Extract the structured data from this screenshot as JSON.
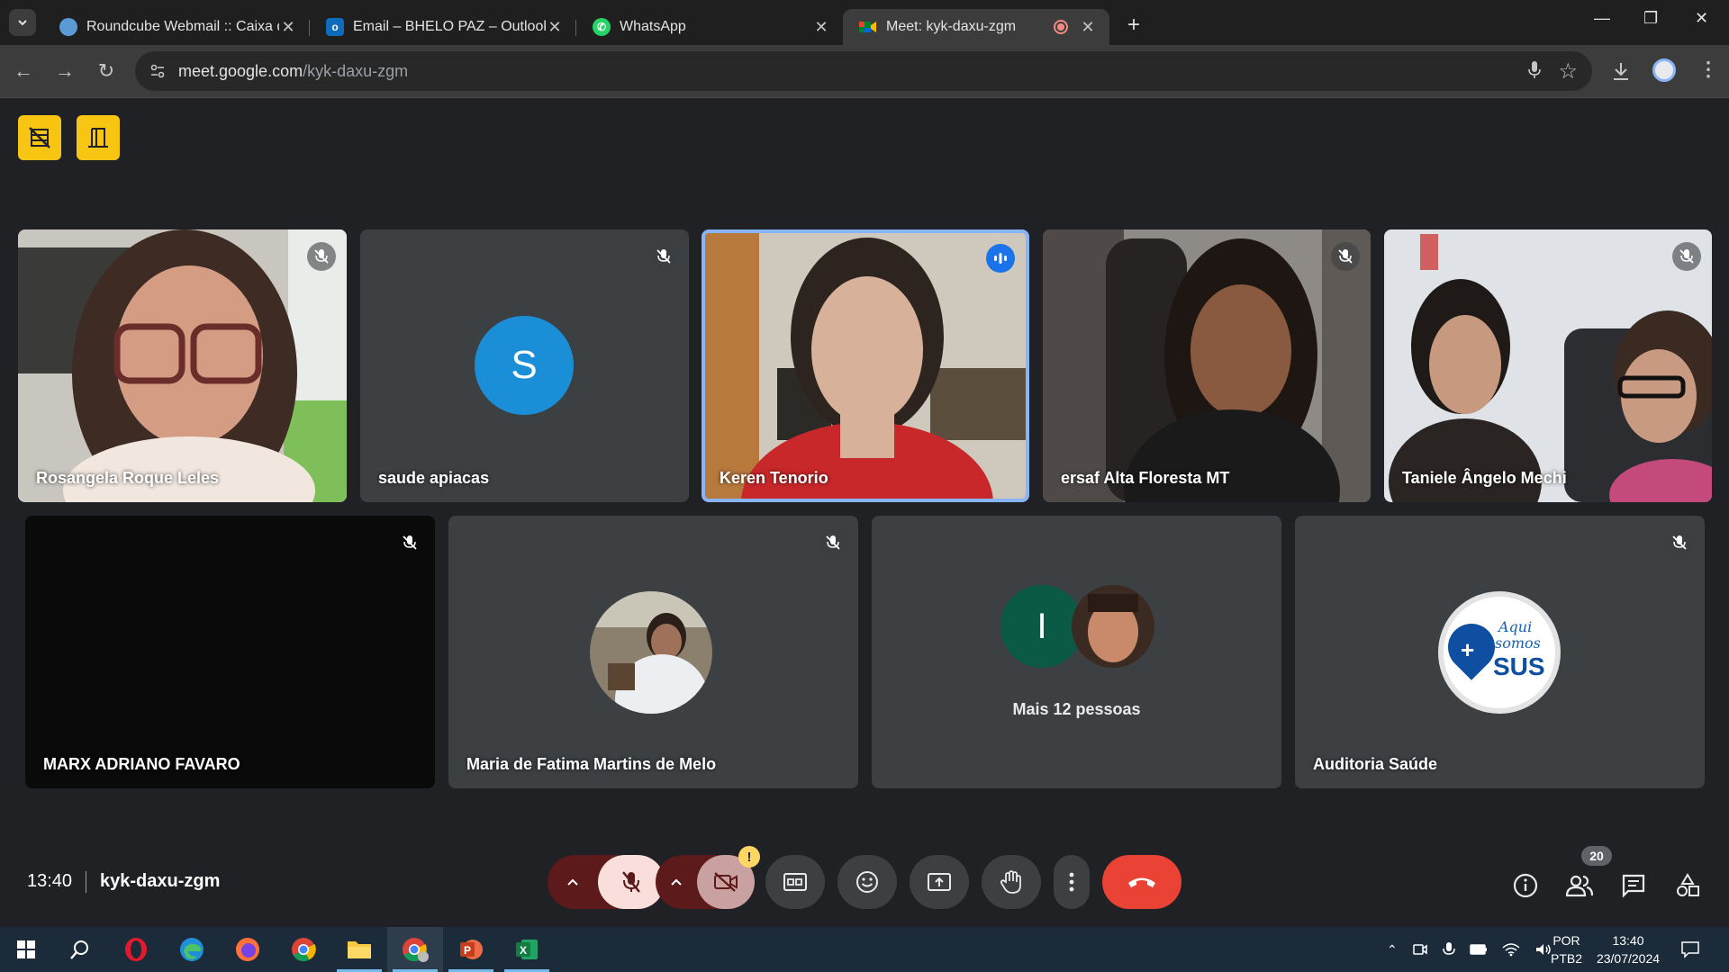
{
  "browser": {
    "tabs": [
      {
        "title": "Roundcube Webmail :: Caixa de"
      },
      {
        "title": "Email – BHELO PAZ – Outlook"
      },
      {
        "title": "WhatsApp"
      },
      {
        "title": "Meet: kyk-daxu-zgm"
      }
    ],
    "url_host": "meet.google.com",
    "url_path": "/kyk-daxu-zgm"
  },
  "participants_row1": [
    {
      "name": "Rosangela Roque Leles"
    },
    {
      "name": "saude apiacas",
      "initial": "S"
    },
    {
      "name": "Keren Tenorio"
    },
    {
      "name": "ersaf Alta Floresta MT"
    },
    {
      "name": "Taniele Ângelo Mechi"
    }
  ],
  "participants_row2": [
    {
      "name": "MARX ADRIANO FAVARO"
    },
    {
      "name": "Maria de Fatima Martins de Melo"
    },
    {
      "name": "",
      "initial": "I",
      "more_label": "Mais 12 pessoas"
    },
    {
      "name": "Auditoria Saúde",
      "logo_text_1": "Aqui",
      "logo_text_2": "somos",
      "logo_text_3": "SUS"
    }
  ],
  "meeting": {
    "time": "13:40",
    "code": "kyk-daxu-zgm",
    "people_count": "20",
    "camera_warning": "!"
  },
  "taskbar": {
    "lang_1": "POR",
    "lang_2": "PTB2",
    "time": "13:40",
    "date": "23/07/2024"
  },
  "colors": {
    "accent_blue": "#1a73e8",
    "end_call_red": "#ea4335",
    "mic_off_bg": "#f9dedc",
    "ext_yellow": "#f9c513"
  }
}
